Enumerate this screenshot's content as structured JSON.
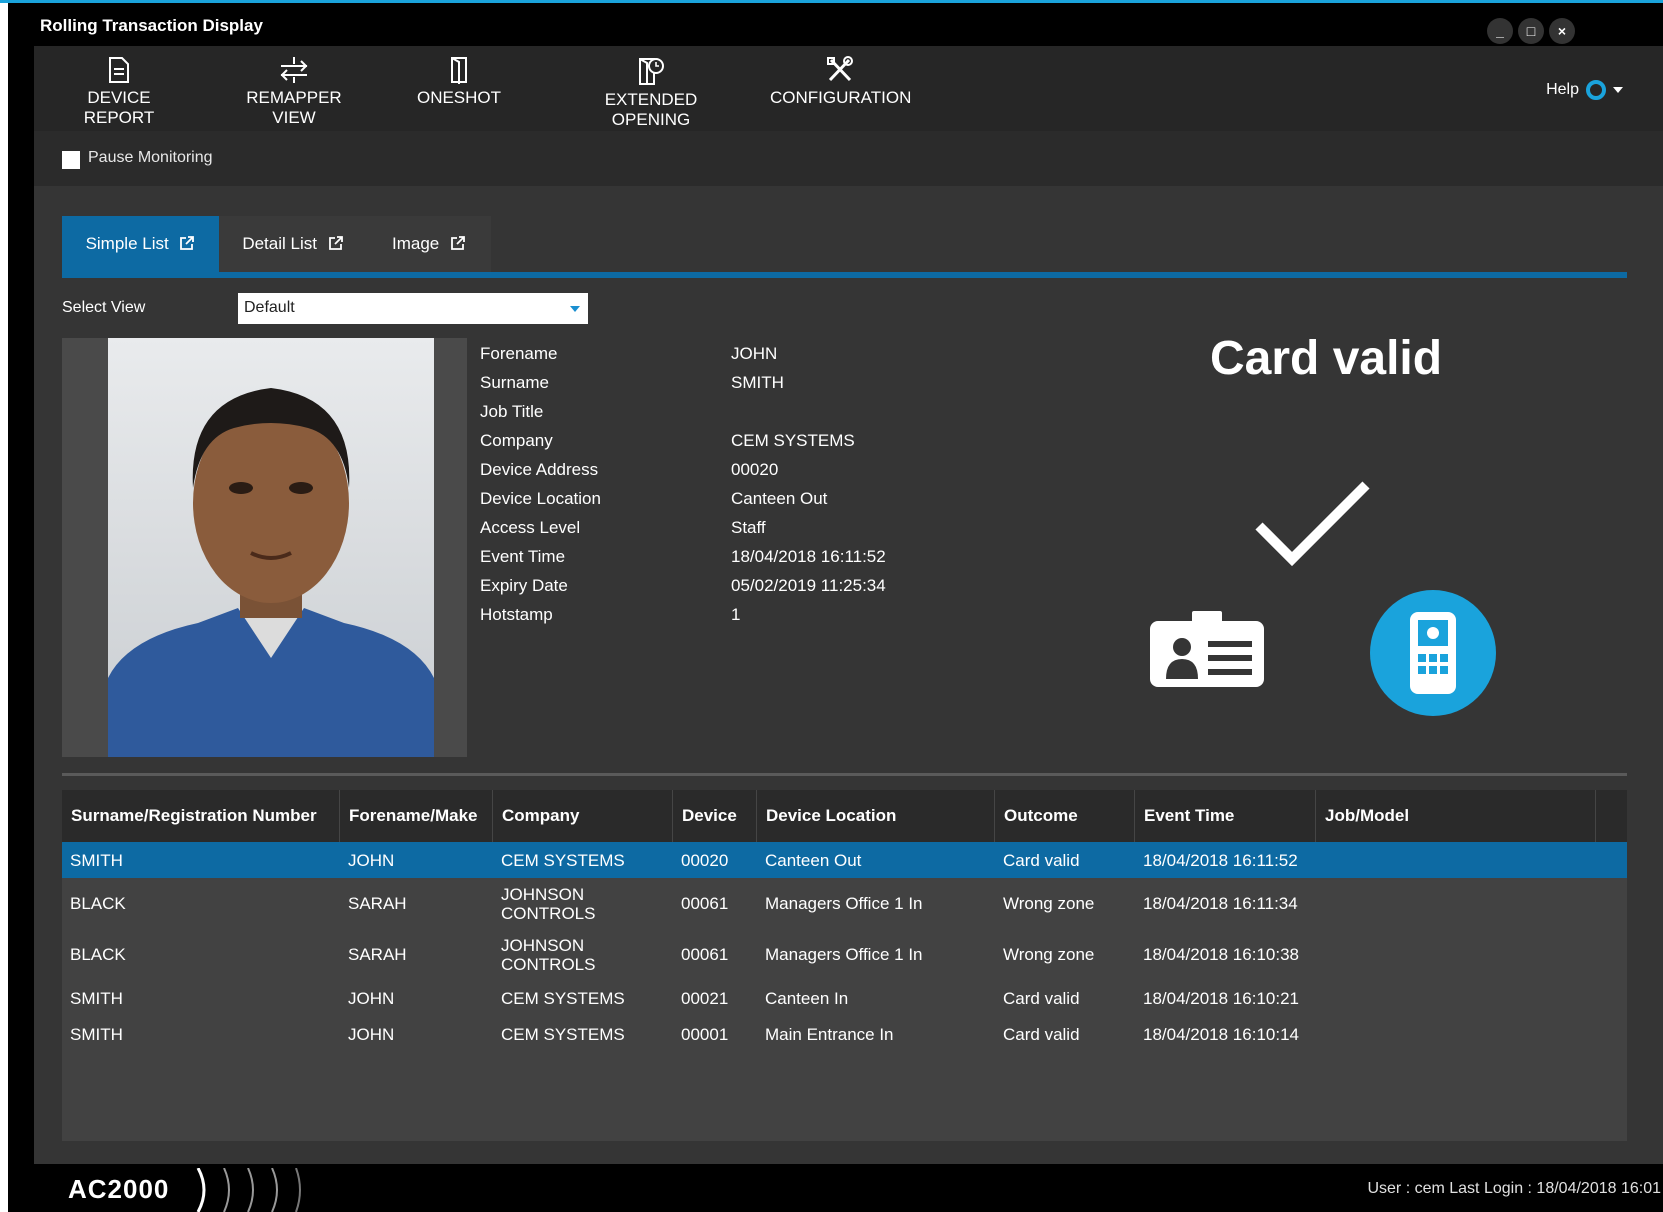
{
  "window": {
    "title": "Rolling Transaction Display",
    "controls": [
      "_",
      "□",
      "×"
    ]
  },
  "toolbar": {
    "items": [
      {
        "label": "DEVICE REPORT",
        "icon": "document-icon"
      },
      {
        "label": "REMAPPER VIEW",
        "icon": "remap-icon"
      },
      {
        "label": "ONESHOT",
        "icon": "door-icon"
      },
      {
        "label": "EXTENDED OPENING",
        "icon": "door-timer-icon"
      },
      {
        "label": "CONFIGURATION",
        "icon": "tools-icon"
      }
    ],
    "help_label": "Help"
  },
  "pause": {
    "label": "Pause Monitoring",
    "checked": false
  },
  "tabs": [
    {
      "label": "Simple List",
      "active": true
    },
    {
      "label": "Detail List",
      "active": false
    },
    {
      "label": "Image",
      "active": false
    }
  ],
  "select_view": {
    "label": "Select View",
    "value": "Default"
  },
  "details": [
    {
      "label": "Forename",
      "value": "JOHN"
    },
    {
      "label": "Surname",
      "value": "SMITH"
    },
    {
      "label": "Job Title",
      "value": ""
    },
    {
      "label": "Company",
      "value": "CEM SYSTEMS"
    },
    {
      "label": "Device Address",
      "value": "00020"
    },
    {
      "label": "Device Location",
      "value": "Canteen Out"
    },
    {
      "label": "Access Level",
      "value": "Staff"
    },
    {
      "label": "Event Time",
      "value": "18/04/2018 16:11:52"
    },
    {
      "label": "Expiry Date",
      "value": "05/02/2019 11:25:34"
    },
    {
      "label": "Hotstamp",
      "value": "1"
    }
  ],
  "status": {
    "text": "Card valid",
    "accent": "#1aa3dc"
  },
  "table": {
    "columns": [
      "Surname/Registration Number",
      "Forename/Make",
      "Company",
      "Device",
      "Device Location",
      "Outcome",
      "Event Time",
      "Job/Model"
    ],
    "rows": [
      [
        "SMITH",
        "JOHN",
        "CEM SYSTEMS",
        "00020",
        "Canteen Out",
        "Card valid",
        "18/04/2018 16:11:52",
        ""
      ],
      [
        "BLACK",
        "SARAH",
        "JOHNSON CONTROLS",
        "00061",
        "Managers Office 1 In",
        "Wrong zone",
        "18/04/2018 16:11:34",
        ""
      ],
      [
        "BLACK",
        "SARAH",
        "JOHNSON CONTROLS",
        "00061",
        "Managers Office 1 In",
        "Wrong zone",
        "18/04/2018 16:10:38",
        ""
      ],
      [
        "SMITH",
        "JOHN",
        "CEM SYSTEMS",
        "00021",
        "Canteen In",
        "Card valid",
        "18/04/2018 16:10:21",
        ""
      ],
      [
        "SMITH",
        "JOHN",
        "CEM SYSTEMS",
        "00001",
        "Main Entrance In",
        "Card valid",
        "18/04/2018 16:10:14",
        ""
      ]
    ],
    "selected_row": 0
  },
  "footer": {
    "logo": "AC2000",
    "user_info": "User : cem   Last Login : 18/04/2018 16:01"
  },
  "colors": {
    "accent": "#0d6aa3",
    "highlight": "#1aa3dc",
    "background": "#353535"
  }
}
